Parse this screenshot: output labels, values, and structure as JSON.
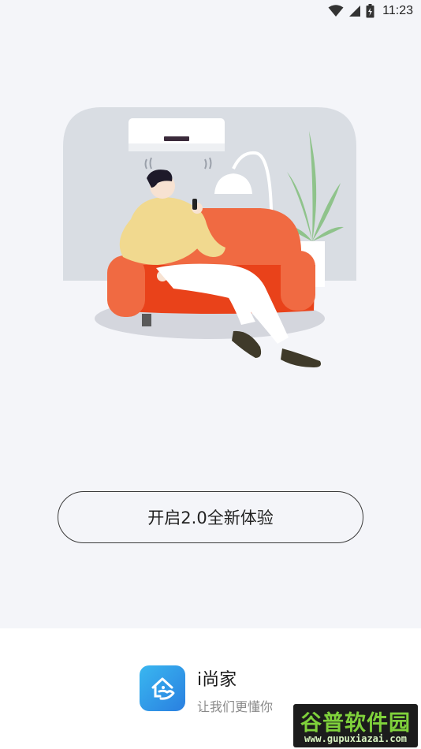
{
  "status_bar": {
    "time": "11:23",
    "icons": [
      "wifi-icon",
      "signal-icon",
      "battery-icon"
    ]
  },
  "illustration": {
    "subject": "person-on-sofa-with-air-conditioner",
    "colors": {
      "backdrop": "#d9dde3",
      "sofa": "#f06a42",
      "sofa_cushion": "#e9421a",
      "shirt": "#f1d98f",
      "pants": "#ffffff",
      "plant": "#8fc38b",
      "floor_shadow": "#d4d6dd"
    }
  },
  "main": {
    "start_button_label": "开启2.0全新体验"
  },
  "footer": {
    "app_name": "i尚家",
    "slogan": "让我们更懂你",
    "icon": "home-hand-icon",
    "brand_color": "#2a8de8"
  },
  "watermark": {
    "title": "谷普软件园",
    "url": "www.gupuxiazai.com"
  }
}
